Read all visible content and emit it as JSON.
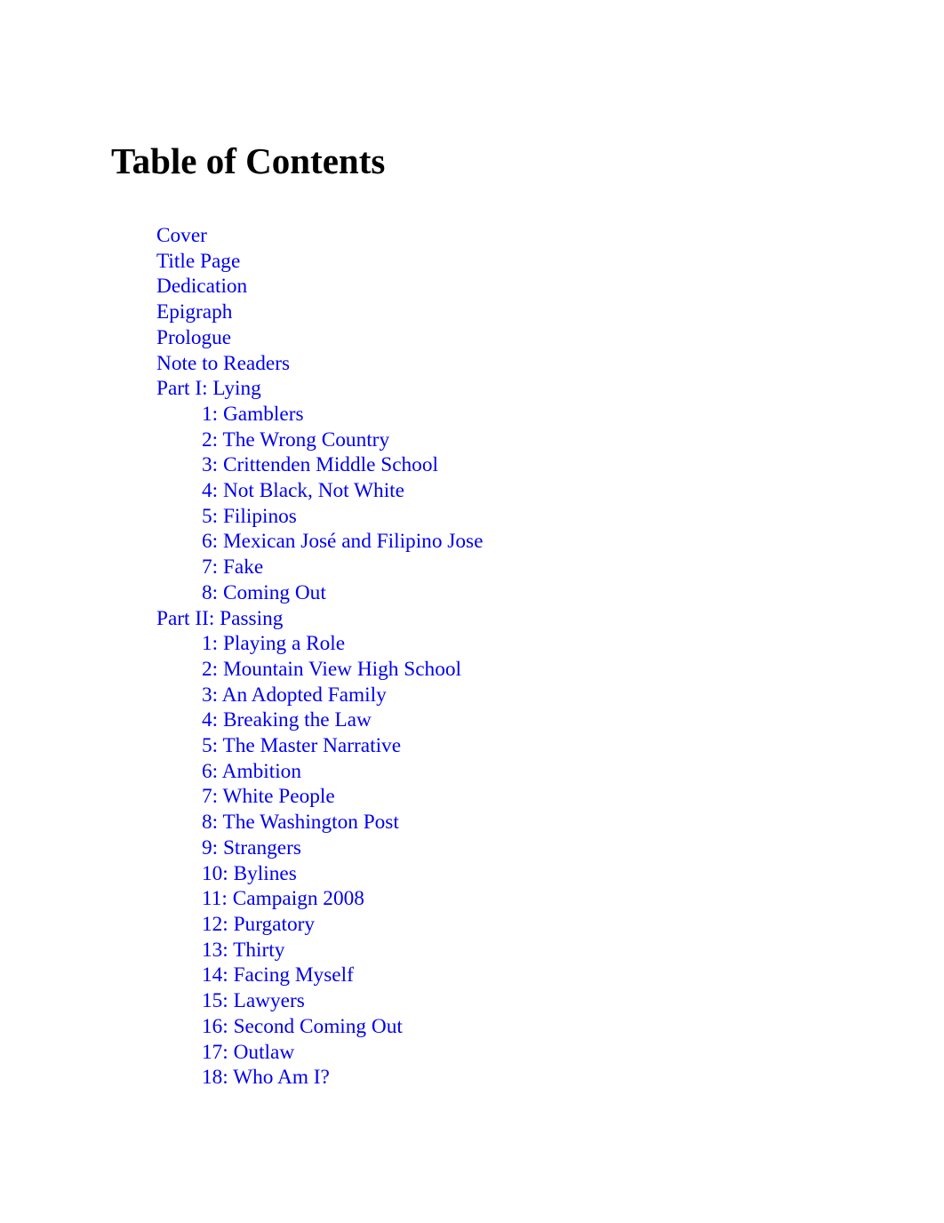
{
  "document": {
    "title": "Table of Contents",
    "link_color": "#0000EE",
    "text_color": "#000000",
    "background_color": "#FFFFFF"
  },
  "toc": {
    "heading": "Table of Contents",
    "entries": [
      {
        "label": "Cover",
        "level": 1
      },
      {
        "label": "Title Page",
        "level": 1
      },
      {
        "label": "Dedication",
        "level": 1
      },
      {
        "label": "Epigraph",
        "level": 1
      },
      {
        "label": "Prologue",
        "level": 1
      },
      {
        "label": "Note to Readers",
        "level": 1
      },
      {
        "label": "Part I: Lying",
        "level": 1
      },
      {
        "label": "1: Gamblers",
        "level": 2
      },
      {
        "label": "2: The Wrong Country",
        "level": 2
      },
      {
        "label": "3: Crittenden Middle School",
        "level": 2
      },
      {
        "label": "4: Not Black, Not White",
        "level": 2
      },
      {
        "label": "5: Filipinos",
        "level": 2
      },
      {
        "label": "6: Mexican José and Filipino Jose",
        "level": 2
      },
      {
        "label": "7: Fake",
        "level": 2
      },
      {
        "label": "8: Coming Out",
        "level": 2
      },
      {
        "label": "Part II: Passing",
        "level": 1
      },
      {
        "label": "1: Playing a Role",
        "level": 2
      },
      {
        "label": "2: Mountain View High School",
        "level": 2
      },
      {
        "label": "3: An Adopted Family",
        "level": 2
      },
      {
        "label": "4: Breaking the Law",
        "level": 2
      },
      {
        "label": "5: The Master Narrative",
        "level": 2
      },
      {
        "label": "6: Ambition",
        "level": 2
      },
      {
        "label": "7: White People",
        "level": 2
      },
      {
        "label": "8: The Washington Post",
        "level": 2
      },
      {
        "label": "9: Strangers",
        "level": 2
      },
      {
        "label": "10: Bylines",
        "level": 2
      },
      {
        "label": "11: Campaign 2008",
        "level": 2
      },
      {
        "label": "12: Purgatory",
        "level": 2
      },
      {
        "label": "13: Thirty",
        "level": 2
      },
      {
        "label": "14: Facing Myself",
        "level": 2
      },
      {
        "label": "15: Lawyers",
        "level": 2
      },
      {
        "label": "16: Second Coming Out",
        "level": 2
      },
      {
        "label": "17: Outlaw",
        "level": 2
      },
      {
        "label": "18: Who Am I?",
        "level": 2
      }
    ]
  }
}
